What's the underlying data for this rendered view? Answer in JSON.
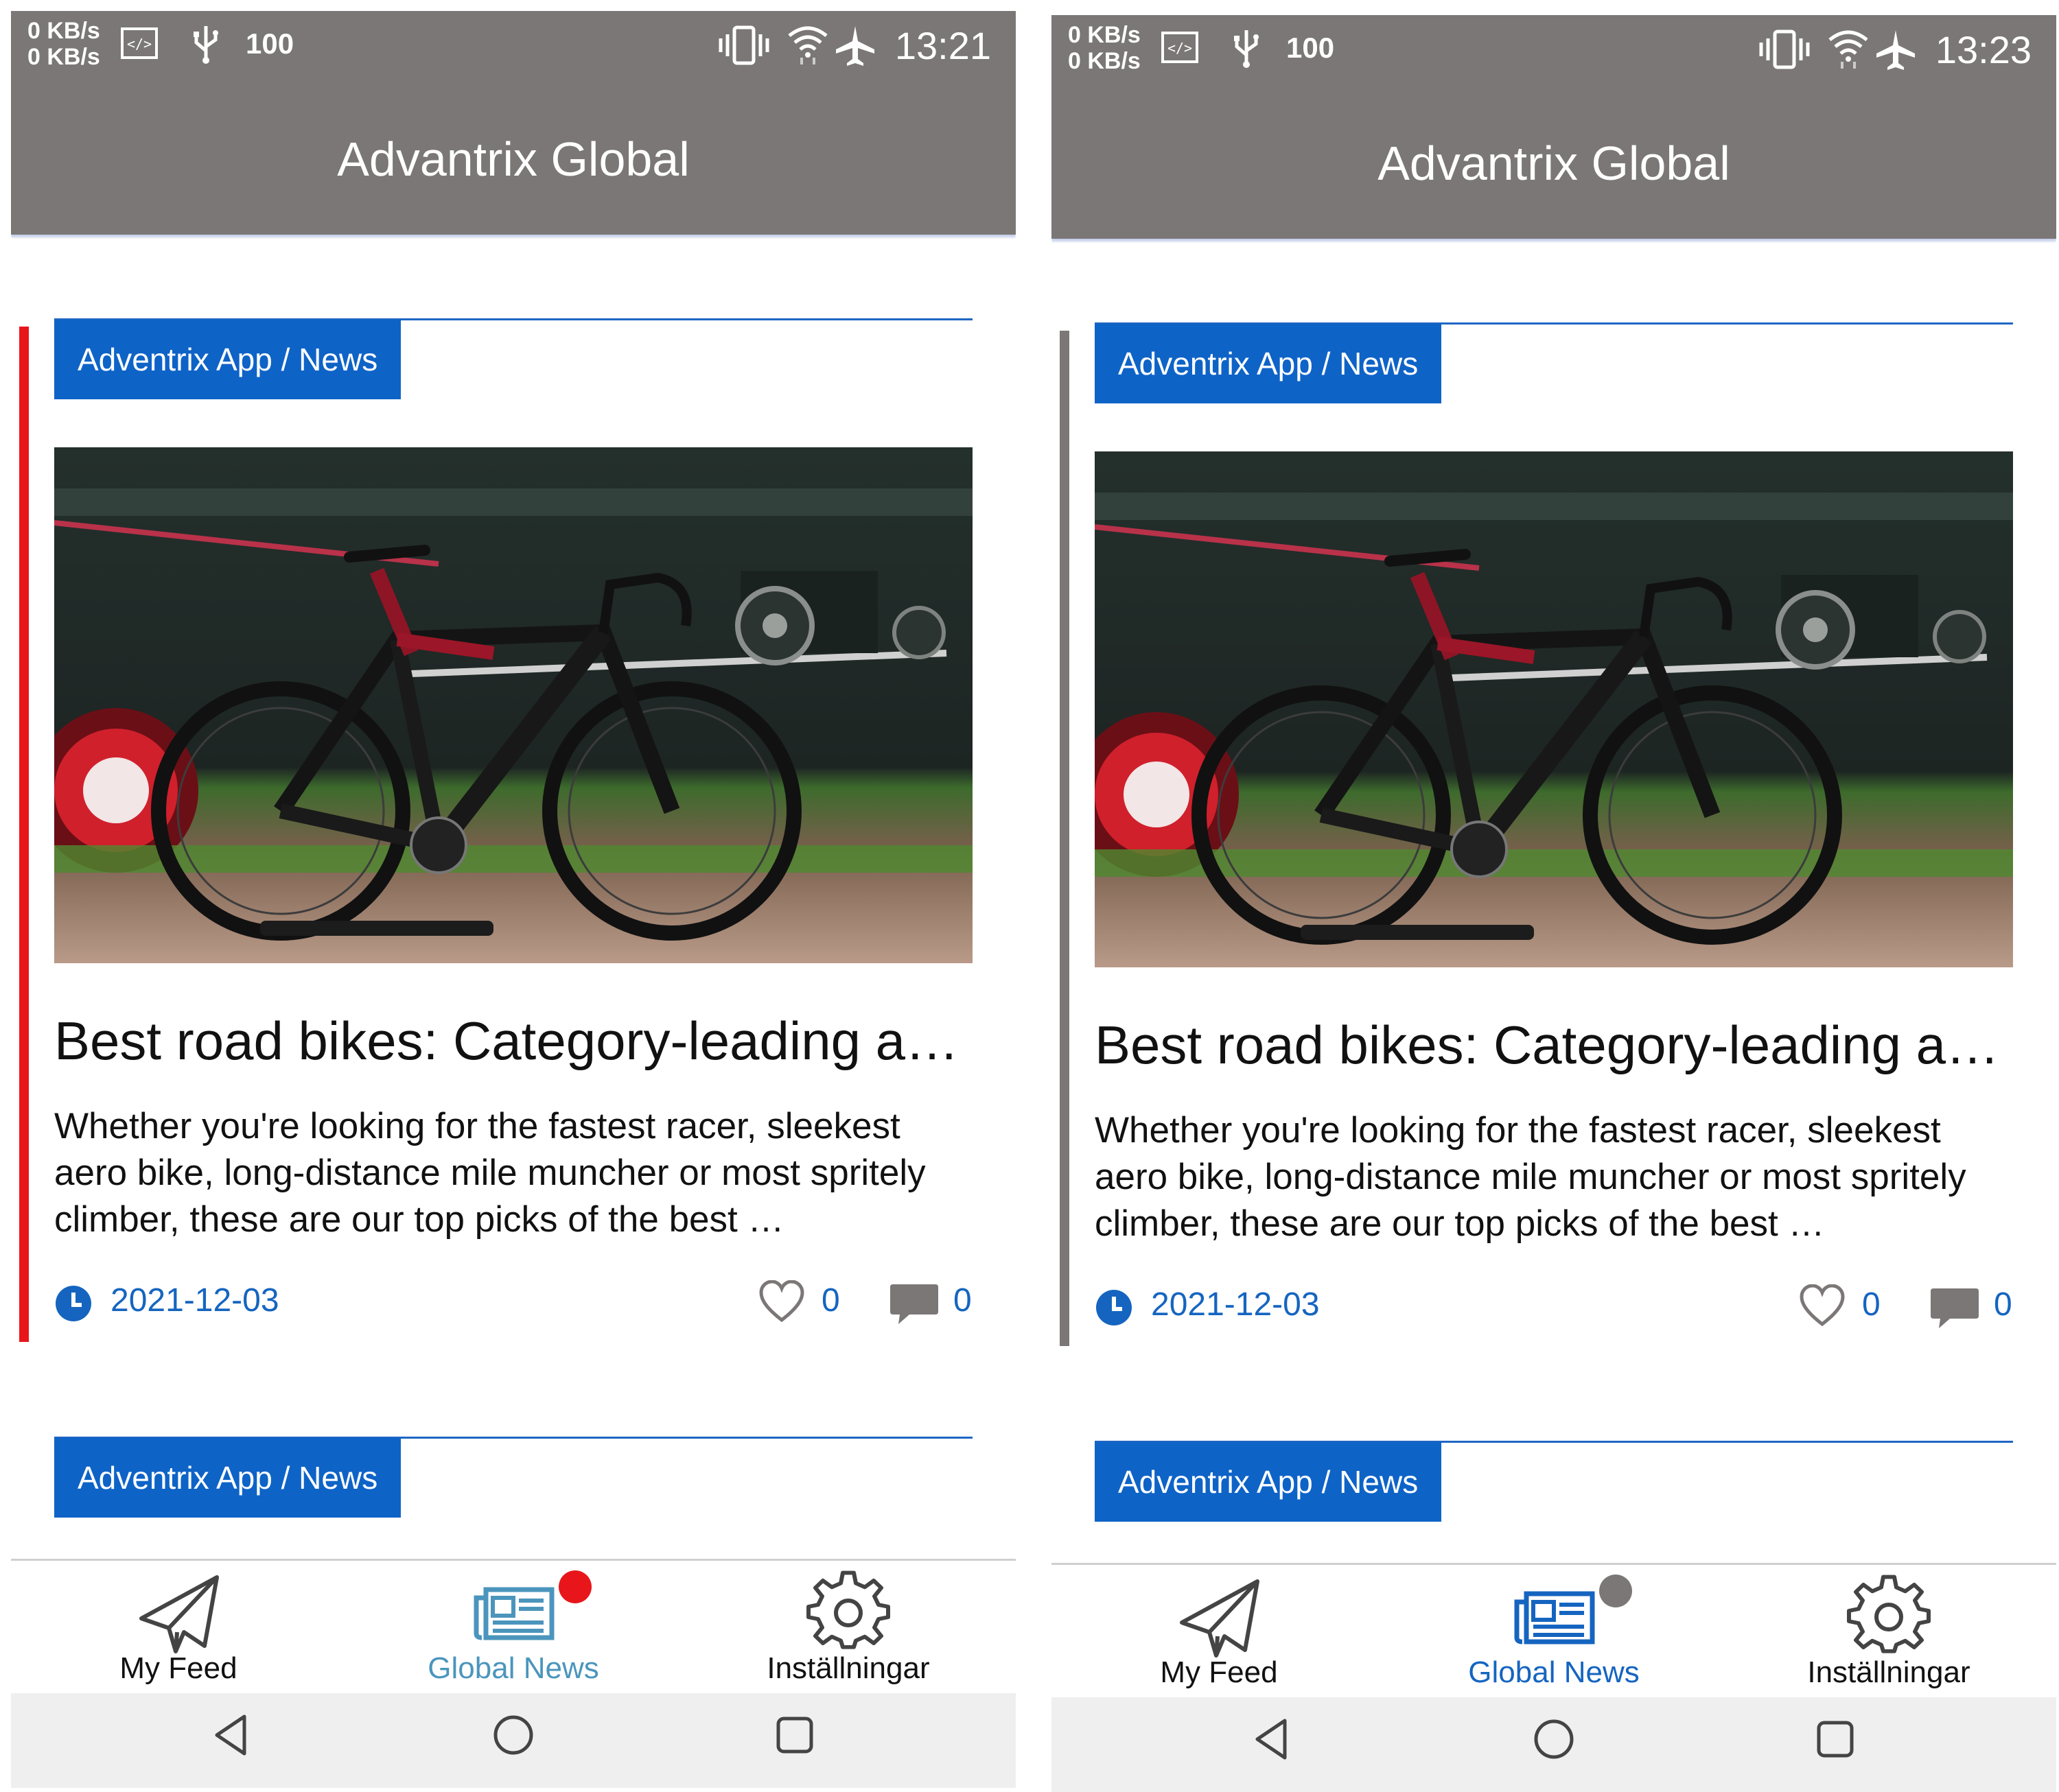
{
  "screens": [
    {
      "status": {
        "net_up": "0 KB/s",
        "net_down": "0 KB/s",
        "battery": "100",
        "time": "13:21"
      },
      "app_title": "Advantrix Global",
      "accent_bar_color": "#e8161b",
      "cards": [
        {
          "category": "Adventrix App / News",
          "title": "Best road bikes: Category-leading a…",
          "excerpt": "Whether you're looking for the fastest racer, sleekest aero bike, long-distance mile muncher or most spritely climber, these are our top picks of the best …",
          "date": "2021-12-03",
          "likes": "0",
          "comments": "0"
        },
        {
          "category": "Adventrix App / News"
        }
      ],
      "nav": {
        "items": [
          {
            "label": "My Feed",
            "icon": "paper-plane-icon"
          },
          {
            "label": "Global News",
            "icon": "newspaper-icon",
            "active": true
          },
          {
            "label": "Inställningar",
            "icon": "gear-icon"
          }
        ],
        "active_color": "#4b95bd",
        "badge_color": "#e8161b"
      }
    },
    {
      "status": {
        "net_up": "0 KB/s",
        "net_down": "0 KB/s",
        "battery": "100",
        "time": "13:23"
      },
      "app_title": "Advantrix Global",
      "accent_bar_color": "#7b7776",
      "cards": [
        {
          "category": "Adventrix App / News",
          "title": "Best road bikes: Category-leading a…",
          "excerpt": "Whether you're looking for the fastest racer, sleekest aero bike, long-distance mile muncher or most spritely climber, these are our top picks of the best …",
          "date": "2021-12-03",
          "likes": "0",
          "comments": "0"
        },
        {
          "category": "Adventrix App / News"
        }
      ],
      "nav": {
        "items": [
          {
            "label": "My Feed",
            "icon": "paper-plane-icon"
          },
          {
            "label": "Global News",
            "icon": "newspaper-icon",
            "active": true
          },
          {
            "label": "Inställningar",
            "icon": "gear-icon"
          }
        ],
        "active_color": "#1565c0",
        "badge_color": "#7b7776"
      }
    }
  ]
}
